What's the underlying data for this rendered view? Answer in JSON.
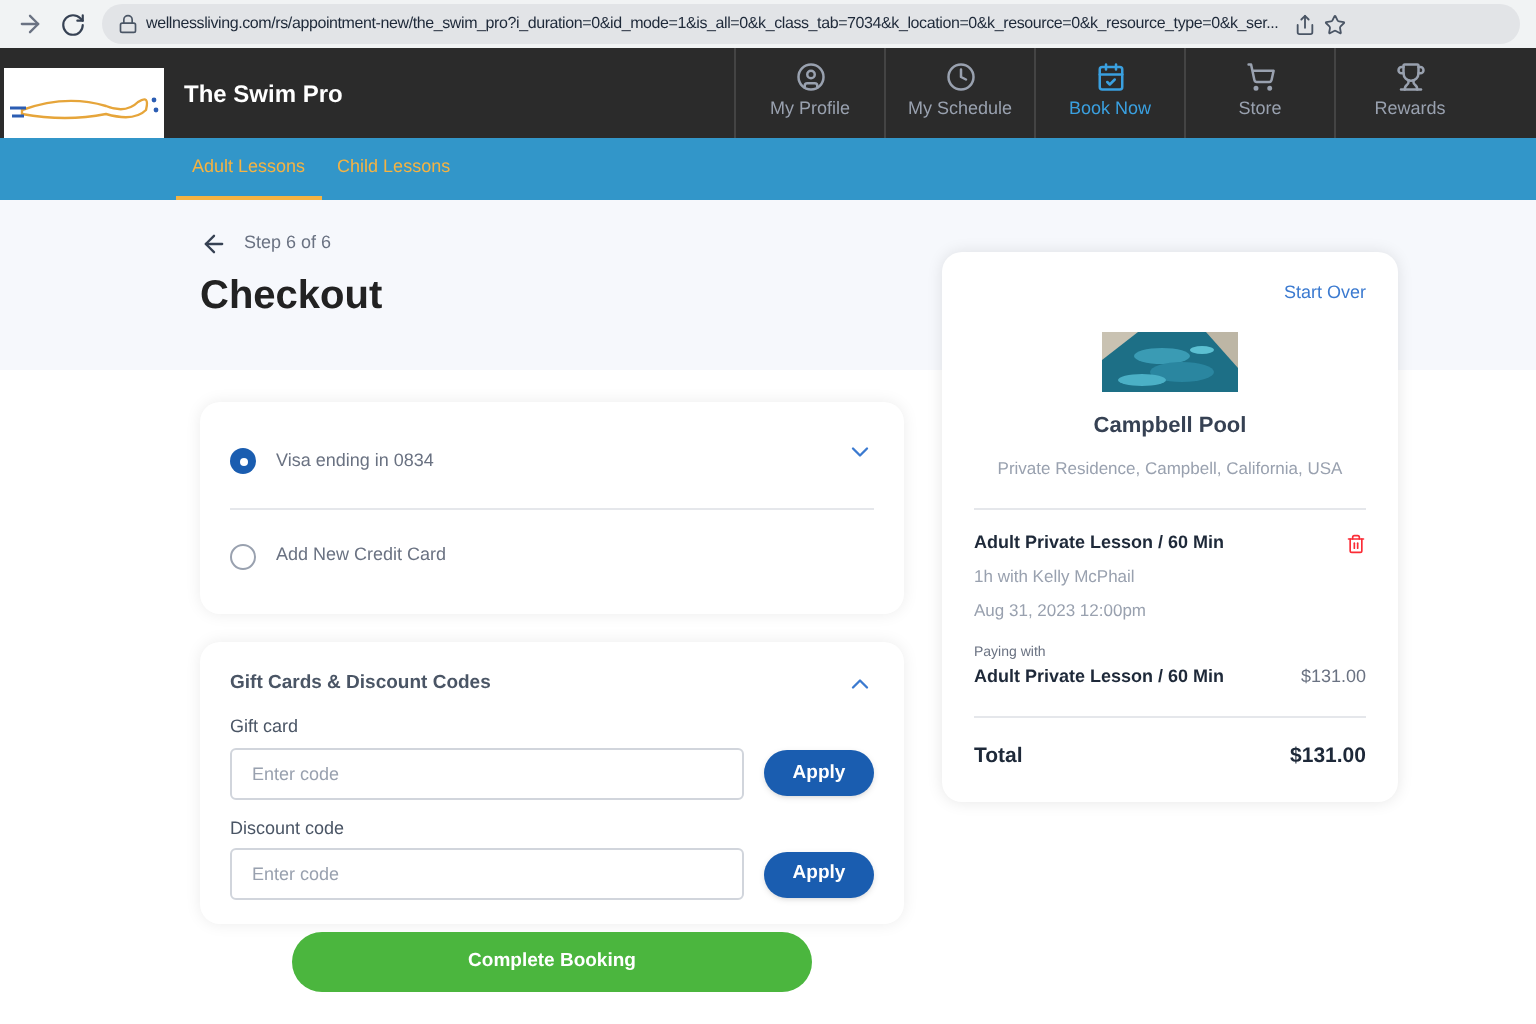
{
  "browser": {
    "url": "wellnessliving.com/rs/appointment-new/the_swim_pro?i_duration=0&id_mode=1&is_all=0&k_class_tab=7034&k_location=0&k_resource=0&k_resource_type=0&k_ser..."
  },
  "header": {
    "business_name": "The Swim Pro",
    "nav": [
      {
        "label": "My Profile",
        "kind": "profile",
        "selected": false
      },
      {
        "label": "My Schedule",
        "kind": "schedule",
        "selected": false
      },
      {
        "label": "Book Now",
        "kind": "book",
        "selected": true
      },
      {
        "label": "Store",
        "kind": "store",
        "selected": false
      },
      {
        "label": "Rewards",
        "kind": "rewards",
        "selected": false
      }
    ]
  },
  "tabs": [
    {
      "label": "Adult Lessons",
      "selected": true
    },
    {
      "label": "Child Lessons",
      "selected": false
    }
  ],
  "step": "Step 6 of 6",
  "title": "Checkout",
  "payment": {
    "expanded": false,
    "options": [
      {
        "label": "Visa ending in 0834",
        "selected": true
      },
      {
        "label": "Add New Credit Card",
        "selected": false
      }
    ]
  },
  "discounts": {
    "title": "Gift Cards & Discount Codes",
    "expanded": true,
    "fields": [
      {
        "label": "Gift card",
        "placeholder": "Enter code",
        "button": "Apply"
      },
      {
        "label": "Discount code",
        "placeholder": "Enter code",
        "button": "Apply"
      }
    ]
  },
  "complete_button": "Complete Booking",
  "summary": {
    "start_over": "Start Over",
    "location": "Campbell Pool",
    "address": "Private Residence, Campbell, California, USA",
    "service": "Adult Private Lesson / 60 Min",
    "duration": "1h with Kelly McPhail",
    "date": "Aug 31, 2023 12:00pm",
    "paying_with_label": "Paying with",
    "paying_with": "Adult Private Lesson / 60 Min",
    "price": "$131.00",
    "total_label": "Total",
    "total": "$131.00"
  }
}
